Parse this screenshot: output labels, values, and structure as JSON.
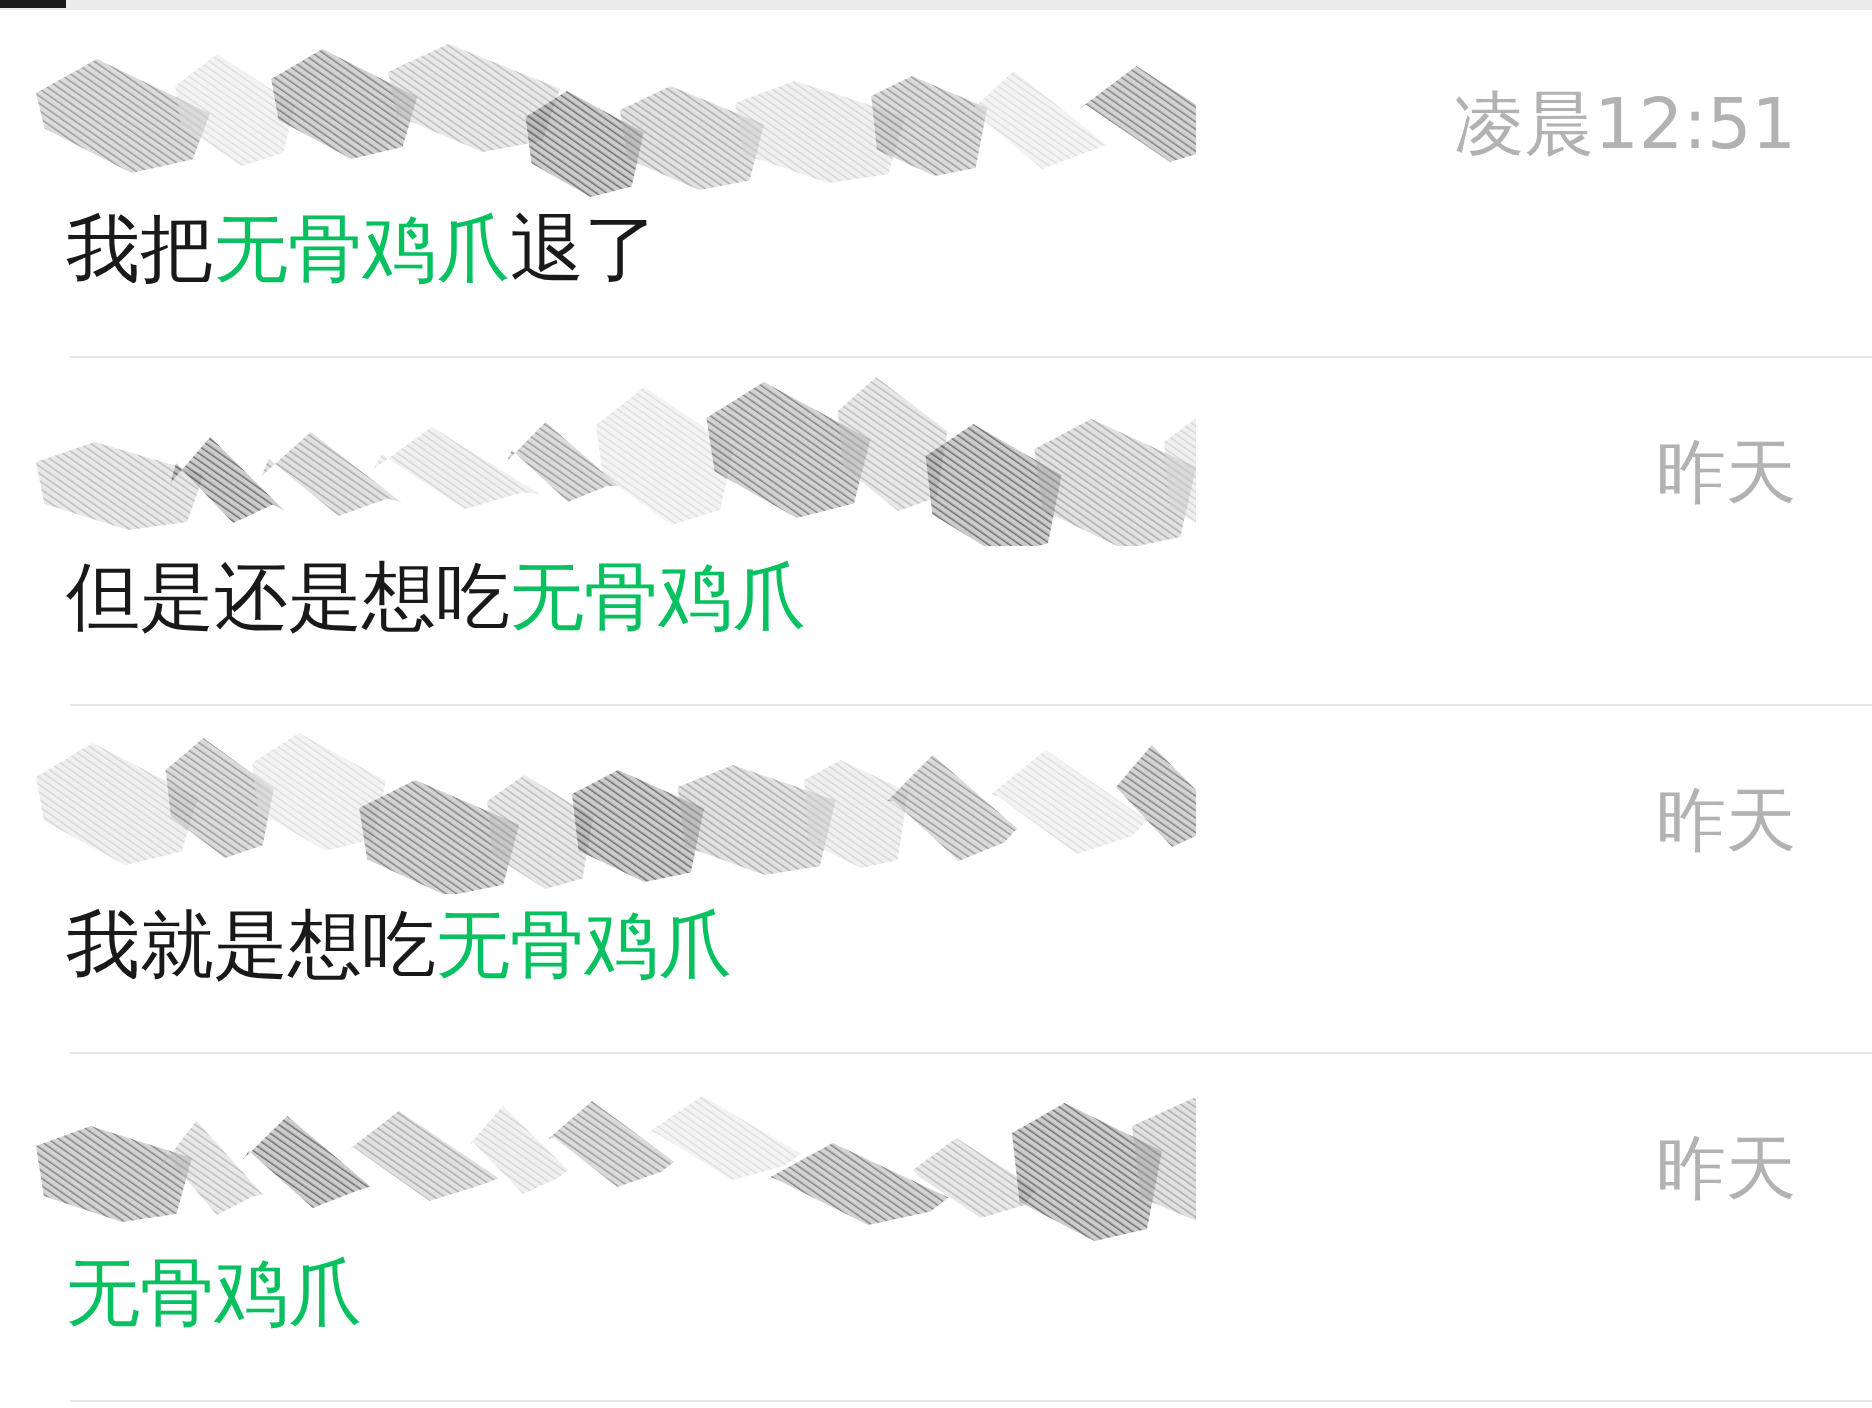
{
  "results": [
    {
      "time": "凌晨12:51",
      "message": [
        {
          "text": "我把",
          "highlight": false
        },
        {
          "text": "无骨鸡爪",
          "highlight": true
        },
        {
          "text": "退了",
          "highlight": false
        }
      ]
    },
    {
      "time": "昨天",
      "message": [
        {
          "text": "但是还是想吃",
          "highlight": false
        },
        {
          "text": "无骨鸡爪",
          "highlight": true
        }
      ]
    },
    {
      "time": "昨天",
      "message": [
        {
          "text": "我就是想吃",
          "highlight": false
        },
        {
          "text": "无骨鸡爪",
          "highlight": true
        }
      ]
    },
    {
      "time": "昨天",
      "message": [
        {
          "text": "无骨鸡爪",
          "highlight": true
        }
      ]
    }
  ]
}
